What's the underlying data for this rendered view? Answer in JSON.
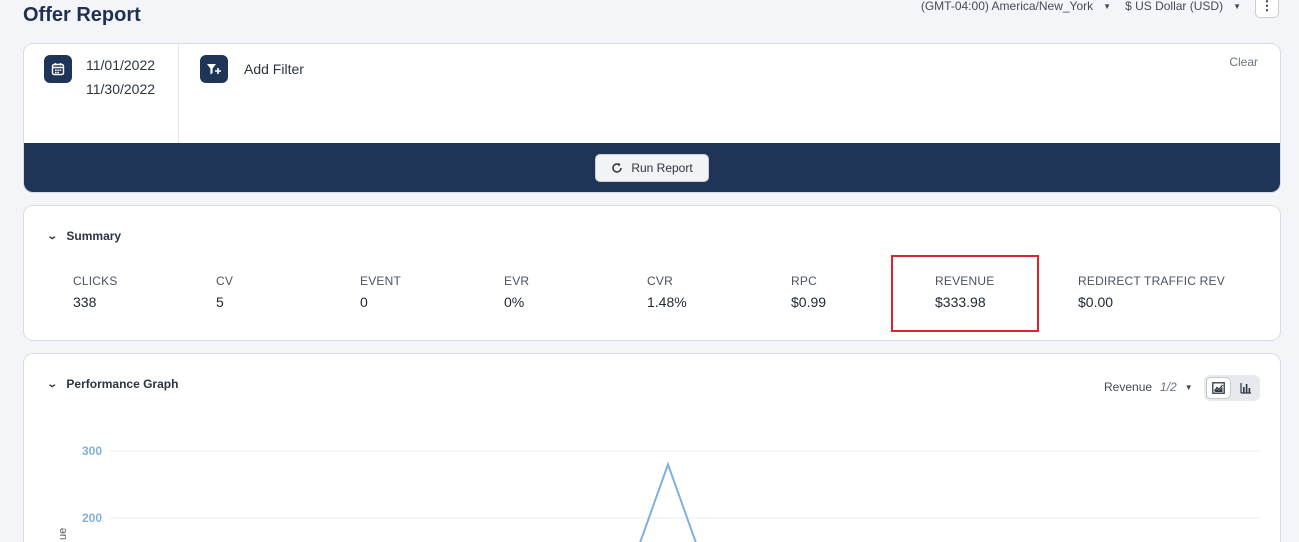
{
  "page": {
    "title": "Offer Report"
  },
  "top_controls": {
    "timezone": "(GMT-04:00) America/New_York",
    "currency": "$ US Dollar (USD)",
    "more": "⋮"
  },
  "filters": {
    "start_date": "11/01/2022",
    "end_date": "11/30/2022",
    "add_filter_label": "Add Filter",
    "clear_label": "Clear",
    "run_report_label": "Run Report"
  },
  "summary": {
    "title": "Summary",
    "metrics": [
      {
        "label": "CLICKS",
        "value": "338"
      },
      {
        "label": "CV",
        "value": "5"
      },
      {
        "label": "EVENT",
        "value": "0"
      },
      {
        "label": "EVR",
        "value": "0%"
      },
      {
        "label": "CVR",
        "value": "1.48%"
      },
      {
        "label": "RPC",
        "value": "$0.99"
      },
      {
        "label": "REVENUE",
        "value": "$333.98"
      },
      {
        "label": "REDIRECT TRAFFIC REV",
        "value": "$0.00"
      }
    ],
    "highlighted_metric": "REVENUE",
    "highlight_color": "#d9262c"
  },
  "performance": {
    "title": "Performance Graph",
    "metric_select": "Revenue",
    "metric_page": "1/2",
    "views": [
      "line-chart-icon",
      "bar-chart-icon"
    ],
    "active_view": "line-chart-icon"
  },
  "chart_data": {
    "type": "line",
    "title": "",
    "ylabel": "ue",
    "yticks": [
      "300",
      "200"
    ],
    "series": [
      {
        "values": [
          {
            "x_frac": 0.0,
            "y": 0
          },
          {
            "x_frac": 0.5,
            "y": 280
          },
          {
            "x_frac": 1.0,
            "y": 0
          }
        ]
      }
    ],
    "ylim": [
      0,
      300
    ],
    "grid": true,
    "line_color": "#7fb0df"
  },
  "colors": {
    "navy": "#1e3557",
    "accent_blue": "#7fb0df"
  }
}
